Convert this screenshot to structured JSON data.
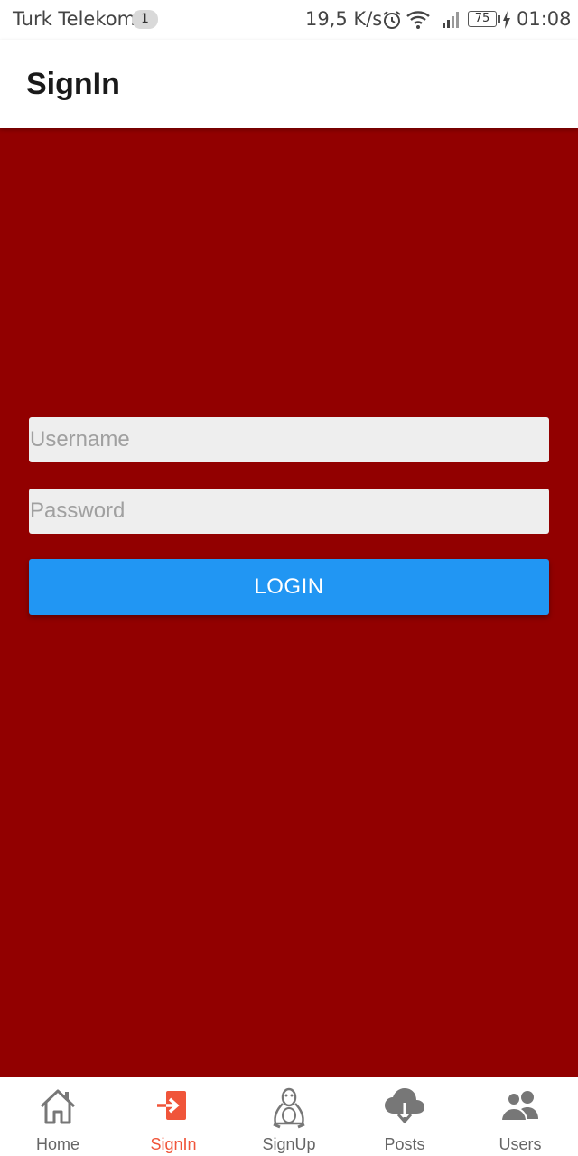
{
  "status_bar": {
    "carrier": "Turk Telekom",
    "notification_count": "1",
    "net_speed": "19,5 K/s",
    "battery": "75",
    "time": "01:08"
  },
  "app_bar": {
    "title": "SignIn"
  },
  "form": {
    "username_placeholder": "Username",
    "username_value": "",
    "password_placeholder": "Password",
    "password_value": "",
    "login_label": "LOGIN"
  },
  "bottom_nav": {
    "items": [
      {
        "label": "Home",
        "icon": "home-icon",
        "active": false
      },
      {
        "label": "SignIn",
        "icon": "sign-in-icon",
        "active": true
      },
      {
        "label": "SignUp",
        "icon": "linux-penguin-icon",
        "active": false
      },
      {
        "label": "Posts",
        "icon": "cloud-download-icon",
        "active": false
      },
      {
        "label": "Users",
        "icon": "users-icon",
        "active": false
      }
    ]
  },
  "colors": {
    "background": "#920000",
    "login_button": "#2196f3",
    "active_tab": "#f0553a",
    "inactive_tab": "#666666",
    "input_bg": "#eeeeee"
  }
}
